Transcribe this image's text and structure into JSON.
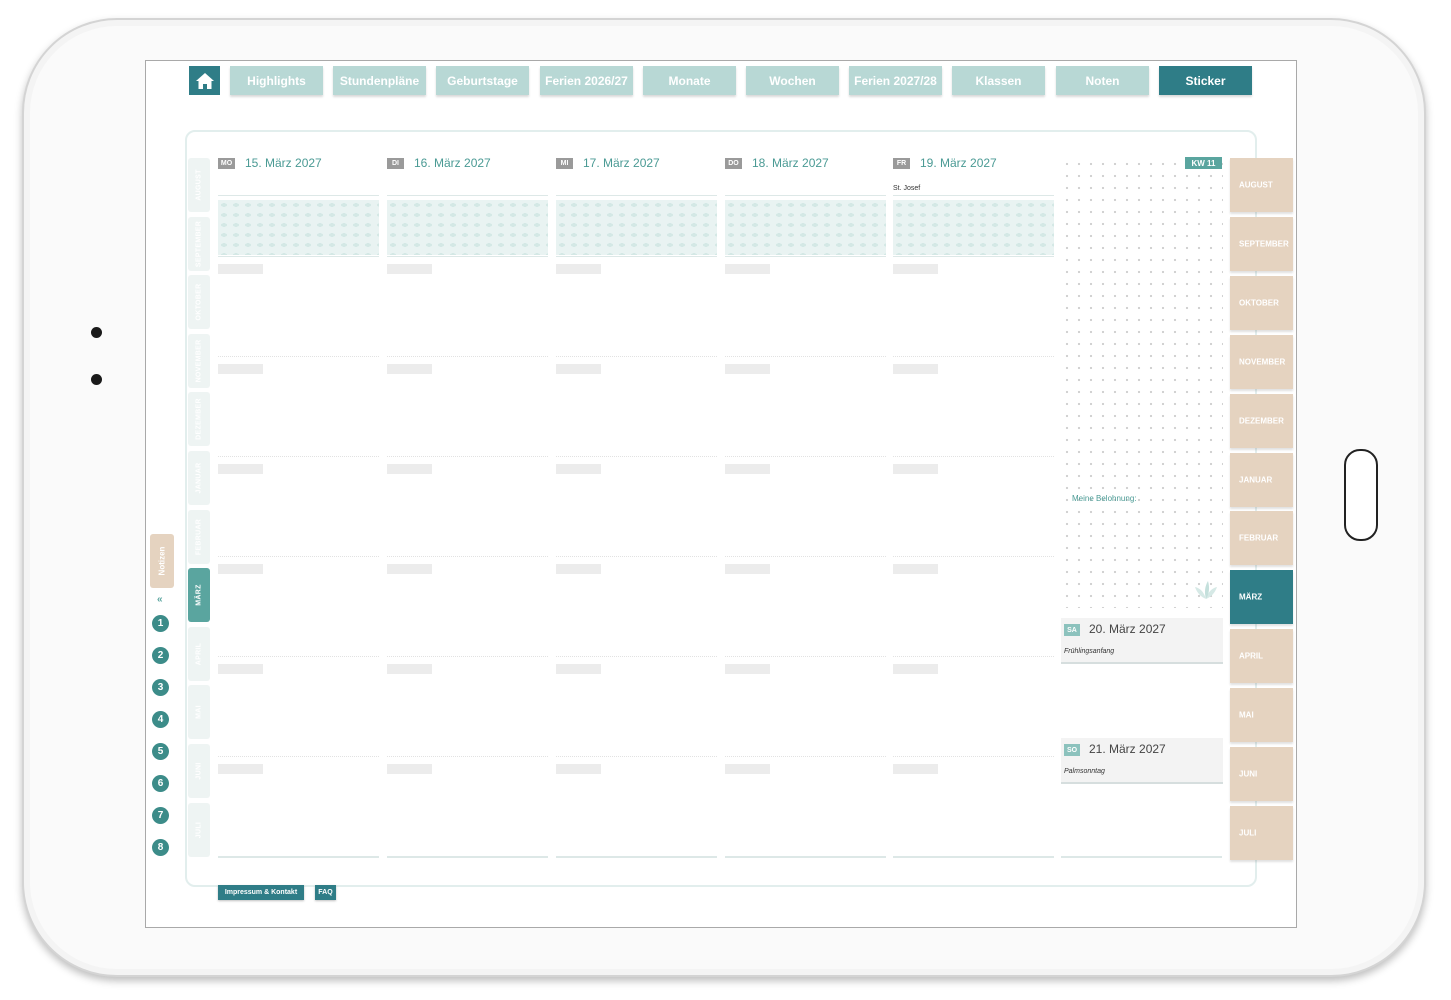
{
  "nav": {
    "tabs": [
      {
        "label": "Highlights"
      },
      {
        "label": "Stundenpläne"
      },
      {
        "label": "Geburtstage"
      },
      {
        "label": "Ferien 2026/27"
      },
      {
        "label": "Monate"
      },
      {
        "label": "Wochen"
      },
      {
        "label": "Ferien 2027/28"
      },
      {
        "label": "Klassen"
      },
      {
        "label": "Noten"
      },
      {
        "label": "Sticker"
      }
    ],
    "active": "Sticker",
    "home_icon": "home-icon"
  },
  "left_months": [
    "AUGUST",
    "SEPTEMBER",
    "OKTOBER",
    "NOVEMBER",
    "DEZEMBER",
    "JANUAR",
    "FEBRUAR",
    "MÄRZ",
    "APRIL",
    "MAI",
    "JUNI",
    "JULI"
  ],
  "right_months": [
    "AUGUST",
    "SEPTEMBER",
    "OKTOBER",
    "NOVEMBER",
    "DEZEMBER",
    "JANUAR",
    "FEBRUAR",
    "MÄRZ",
    "APRIL",
    "MAI",
    "JUNI",
    "JULI"
  ],
  "active_month": "MÄRZ",
  "week": {
    "kw_label": "KW 11",
    "days": [
      {
        "badge": "MO",
        "date": "15. März 2027",
        "holiday": ""
      },
      {
        "badge": "DI",
        "date": "16. März 2027",
        "holiday": ""
      },
      {
        "badge": "MI",
        "date": "17. März 2027",
        "holiday": ""
      },
      {
        "badge": "DO",
        "date": "18. März 2027",
        "holiday": ""
      },
      {
        "badge": "FR",
        "date": "19. März 2027",
        "holiday": "St. Josef"
      }
    ],
    "reward_label": "Meine Belohnung:",
    "weekend": [
      {
        "badge": "SA",
        "date": "20. März 2027",
        "note": "Frühlingsanfang"
      },
      {
        "badge": "SO",
        "date": "21. März 2027",
        "note": "Palmsonntag"
      }
    ]
  },
  "side": {
    "notes_label": "Notizen",
    "collapse_icon": "double-chevron-icon",
    "page_numbers": [
      "1",
      "2",
      "3",
      "4",
      "5",
      "6",
      "7",
      "8"
    ]
  },
  "footer": {
    "imprint": "Impressum & Kontakt",
    "faq": "FAQ"
  },
  "colors": {
    "accent": "#2f7d87",
    "tab_inactive": "#b8d8d5",
    "month_tab": "#e5d3c0",
    "date_text": "#4a9a94"
  }
}
